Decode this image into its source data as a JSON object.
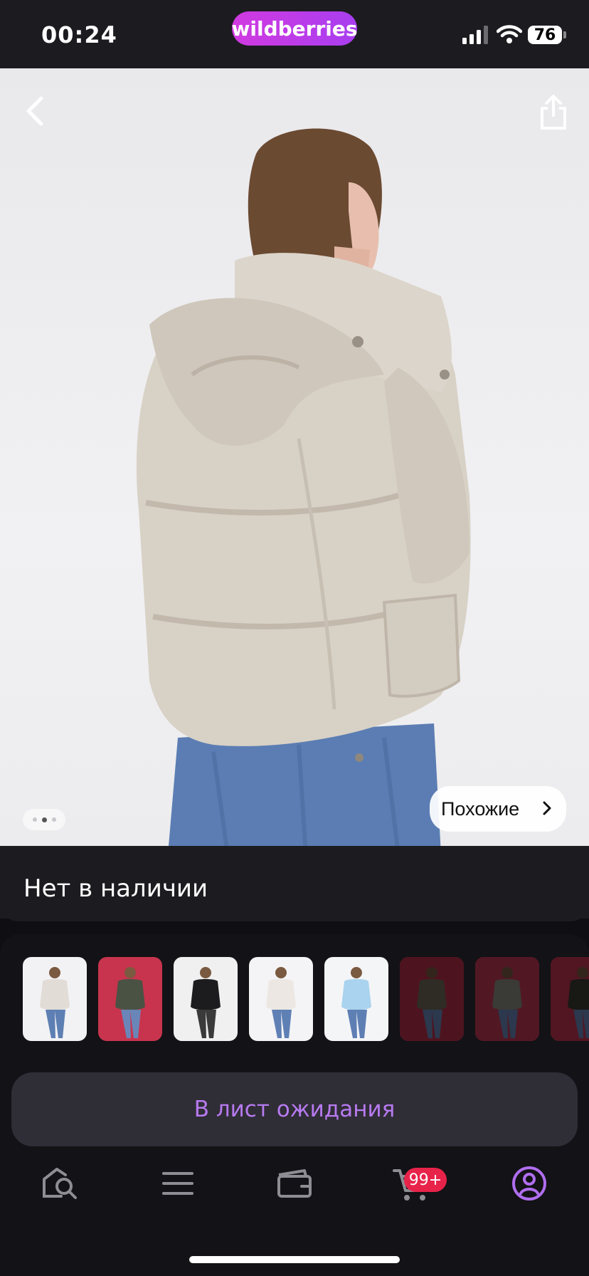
{
  "status_bar": {
    "time": "00:24",
    "brand": "wildberries",
    "battery": "76"
  },
  "photo": {
    "similar_label": "Похожие",
    "pager_total": 3,
    "pager_active": 2
  },
  "availability": {
    "text": "Нет в наличии"
  },
  "thumbnails": [
    {
      "name": "beige-jacket",
      "jacket": "#e2dcd6",
      "bg": "#f2f2f4",
      "jeans": "#5d7fb3",
      "dim": false
    },
    {
      "name": "olive-long-jacket",
      "jacket": "#4a5244",
      "bg": "#c8344d",
      "jeans": "#6a86b8",
      "dim": false
    },
    {
      "name": "black-jacket",
      "jacket": "#1c1c1e",
      "bg": "#f0f0f0",
      "jeans": "#3a3a3a",
      "dim": false
    },
    {
      "name": "cream-jacket",
      "jacket": "#ece7e2",
      "bg": "#f4f4f6",
      "jeans": "#5f80b5",
      "dim": false
    },
    {
      "name": "light-blue-jacket",
      "jacket": "#a9d3ee",
      "bg": "#f4f5f7",
      "jeans": "#5e7fb4",
      "dim": false
    },
    {
      "name": "khaki-long-jacket",
      "jacket": "#6e6a5a",
      "bg": "#b8304a",
      "jeans": "#6a86b8",
      "dim": true
    },
    {
      "name": "grey-long-jacket",
      "jacket": "#8a8a80",
      "bg": "#c03a55",
      "jeans": "#6a86b8",
      "dim": true
    },
    {
      "name": "dark-long-jacket",
      "jacket": "#3a3a34",
      "bg": "#c23650",
      "jeans": "#6a86b8",
      "dim": true
    }
  ],
  "waitlist_button": {
    "label": "В лист ожидания"
  },
  "tabbar": {
    "items": [
      {
        "name": "tab-search",
        "icon": "search-home-icon"
      },
      {
        "name": "tab-catalog",
        "icon": "menu-icon"
      },
      {
        "name": "tab-wallet",
        "icon": "wallet-icon"
      },
      {
        "name": "tab-cart",
        "icon": "cart-icon"
      },
      {
        "name": "tab-profile",
        "icon": "profile-icon"
      }
    ],
    "cart_badge": "99+",
    "active_color": "#b06ef0",
    "inactive_color": "#8e8d94"
  }
}
